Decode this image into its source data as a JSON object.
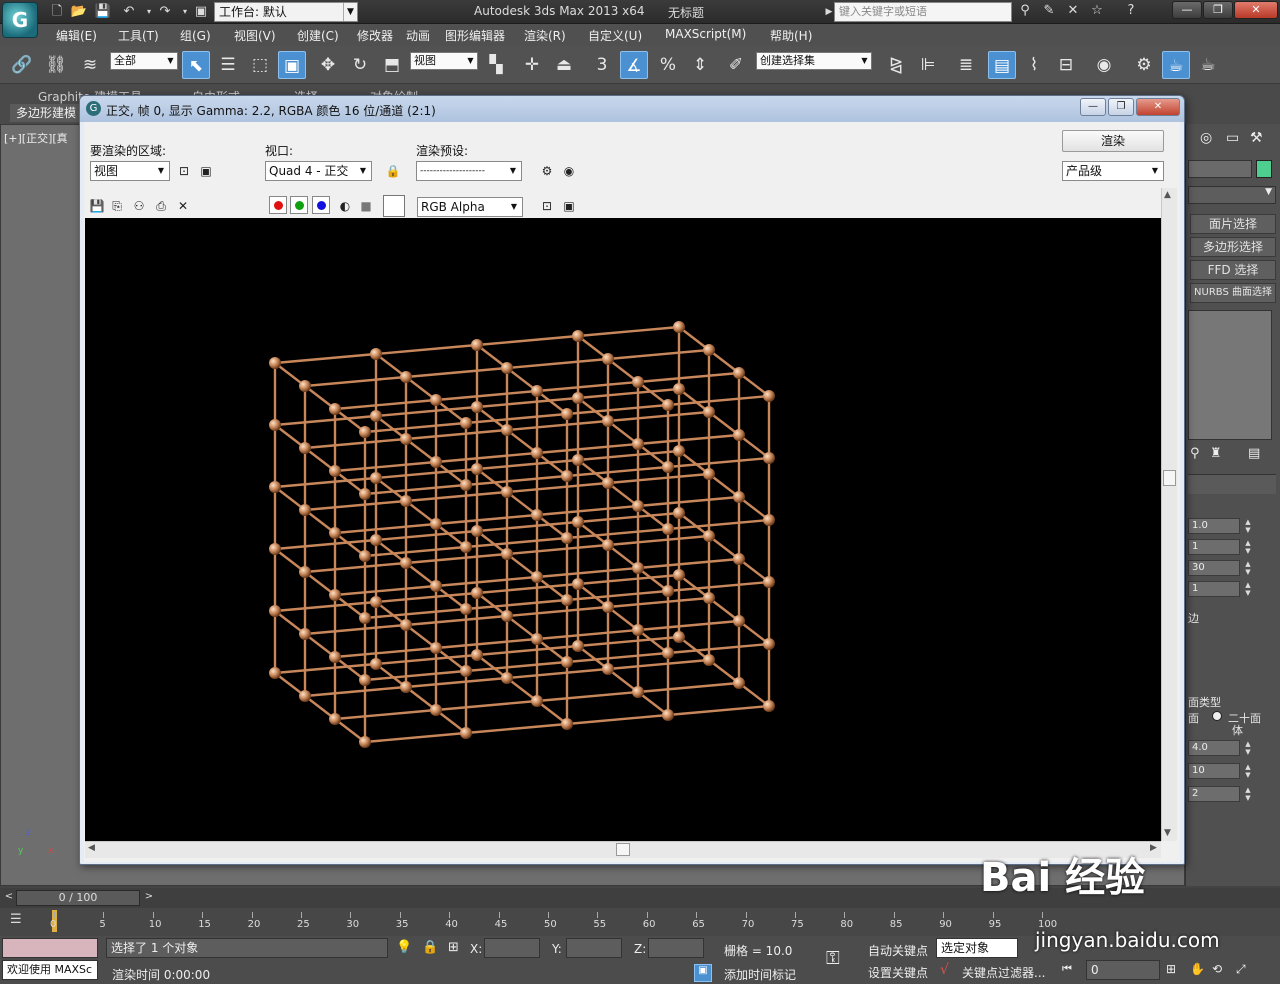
{
  "app": {
    "title": "Autodesk 3ds Max  2013 x64",
    "document": "无标题",
    "logo_glyph": "G",
    "workspace_label": "工作台: 默认",
    "search_placeholder": "键入关键字或短语",
    "search_tools": [
      "binoculars-icon",
      "wrench-icon",
      "star-icon",
      "help-icon"
    ]
  },
  "menu": {
    "items": [
      "编辑(E)",
      "工具(T)",
      "组(G)",
      "视图(V)",
      "创建(C)",
      "修改器",
      "动画",
      "图形编辑器",
      "渲染(R)",
      "自定义(U)",
      "MAXScript(M)",
      "帮助(H)"
    ]
  },
  "toolbar": {
    "filter_label": "全部",
    "ref_coord_label": "视图",
    "named_selection_label": "创建选择集",
    "snap_label": "3"
  },
  "ribbon": {
    "tabs": [
      "Graphite 建模工具",
      "自由形式",
      "选择",
      "对象绘制"
    ],
    "sub_label": "多边形建模"
  },
  "viewport": {
    "label": "[+][正交][真"
  },
  "render_window": {
    "title": "正交, 帧 0, 显示 Gamma: 2.2, RGBA 颜色 16 位/通道 (2:1)",
    "area_label": "要渲染的区域:",
    "area_value": "视图",
    "viewport_label": "视口:",
    "viewport_value": "Quad 4 - 正交",
    "preset_label": "渲染预设:",
    "preset_value": "--------------------",
    "render_button": "渲染",
    "quality_value": "产品级",
    "channel_value": "RGB Alpha",
    "colors": {
      "red": "#e01010",
      "green": "#10a010",
      "blue": "#1010e0",
      "wire": "#c8875a"
    }
  },
  "command_panel": {
    "buttons": [
      "面片选择",
      "多边形选择",
      "FFD 选择",
      "NURBS 曲面选择"
    ],
    "fields": [
      "1.0",
      "1",
      "30",
      "1"
    ],
    "fields2": [
      "4.0",
      "10",
      "2"
    ],
    "face_type_label": "面类型",
    "face_label": "面",
    "icosa_label": "二十面",
    "icosa_label2": "体",
    "edge_label": "边"
  },
  "timeline": {
    "position": "0 / 100",
    "ticks": [
      "0",
      "5",
      "10",
      "15",
      "20",
      "25",
      "30",
      "35",
      "40",
      "45",
      "50",
      "55",
      "60",
      "65",
      "70",
      "75",
      "80",
      "85",
      "90",
      "95",
      "100"
    ]
  },
  "status": {
    "welcome": "欢迎使用 MAXSc",
    "selection": "选择了 1 个对象",
    "render_time": "渲染时间  0:00:00",
    "x_label": "X:",
    "y_label": "Y:",
    "z_label": "Z:",
    "grid": "栅格 = 10.0",
    "add_time_tag": "添加时间标记",
    "auto_key": "自动关键点",
    "set_key": "设置关键点",
    "selected_object": "选定对象",
    "key_filters": "关键点过滤器...",
    "frame": "0"
  },
  "watermark": {
    "text": "Bai  经验",
    "sub": "jingyan.baidu.com"
  }
}
